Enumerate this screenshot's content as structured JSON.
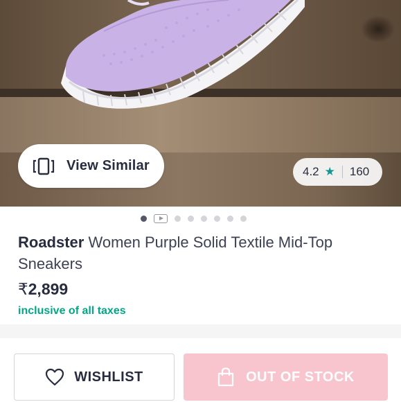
{
  "product_image": {
    "alt_icon": "lavender-knit-sneaker-image",
    "view_similar_label": "View Similar",
    "view_similar_icon": "view-similar-icon",
    "rating": {
      "value": "4.2",
      "star_icon": "star-icon",
      "count": "160",
      "star_color": "#14958f"
    },
    "carousel": {
      "total_dots": 8,
      "active_index": 0,
      "video_index": 1
    }
  },
  "product": {
    "brand": "Roadster",
    "name": "Women Purple Solid Textile Mid-Top Sneakers",
    "currency_symbol": "₹",
    "price": "2,899",
    "tax_note": "inclusive of all taxes",
    "tax_note_color": "#03a685"
  },
  "actions": {
    "wishlist_label": "WISHLIST",
    "wishlist_icon": "heart-icon",
    "out_of_stock_label": "OUT OF STOCK",
    "out_of_stock_icon": "bag-icon",
    "out_of_stock_color": "#f8c5cf"
  }
}
